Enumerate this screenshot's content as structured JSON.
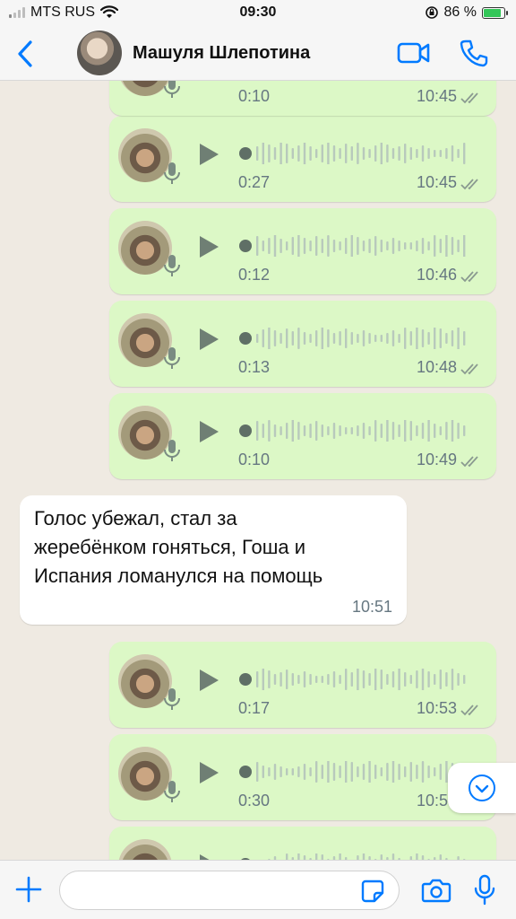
{
  "status_bar": {
    "carrier": "MTS RUS",
    "time": "09:30",
    "battery": "86 %",
    "battery_level": 0.86
  },
  "header": {
    "contact_name": "Машуля Шлепотина"
  },
  "voice_messages": [
    {
      "duration": "0:10",
      "time": "10:45"
    },
    {
      "duration": "0:27",
      "time": "10:45"
    },
    {
      "duration": "0:12",
      "time": "10:46"
    },
    {
      "duration": "0:13",
      "time": "10:48"
    },
    {
      "duration": "0:10",
      "time": "10:49"
    },
    {
      "duration": "0:17",
      "time": "10:53"
    },
    {
      "duration": "0:30",
      "time": "10:55"
    },
    {
      "duration": "",
      "time": ""
    }
  ],
  "text_message": {
    "lines": [
      "Голос убежал, стал за",
      "жеребёнком гоняться, Гоша и",
      "Испания ломанулся на помощь"
    ],
    "time": "10:51"
  },
  "input": {
    "placeholder": ""
  },
  "colors": {
    "accent": "#007aff",
    "outgoing_bubble": "#dcf8c6",
    "incoming_bubble": "#ffffff",
    "chat_background": "#efeae2"
  }
}
